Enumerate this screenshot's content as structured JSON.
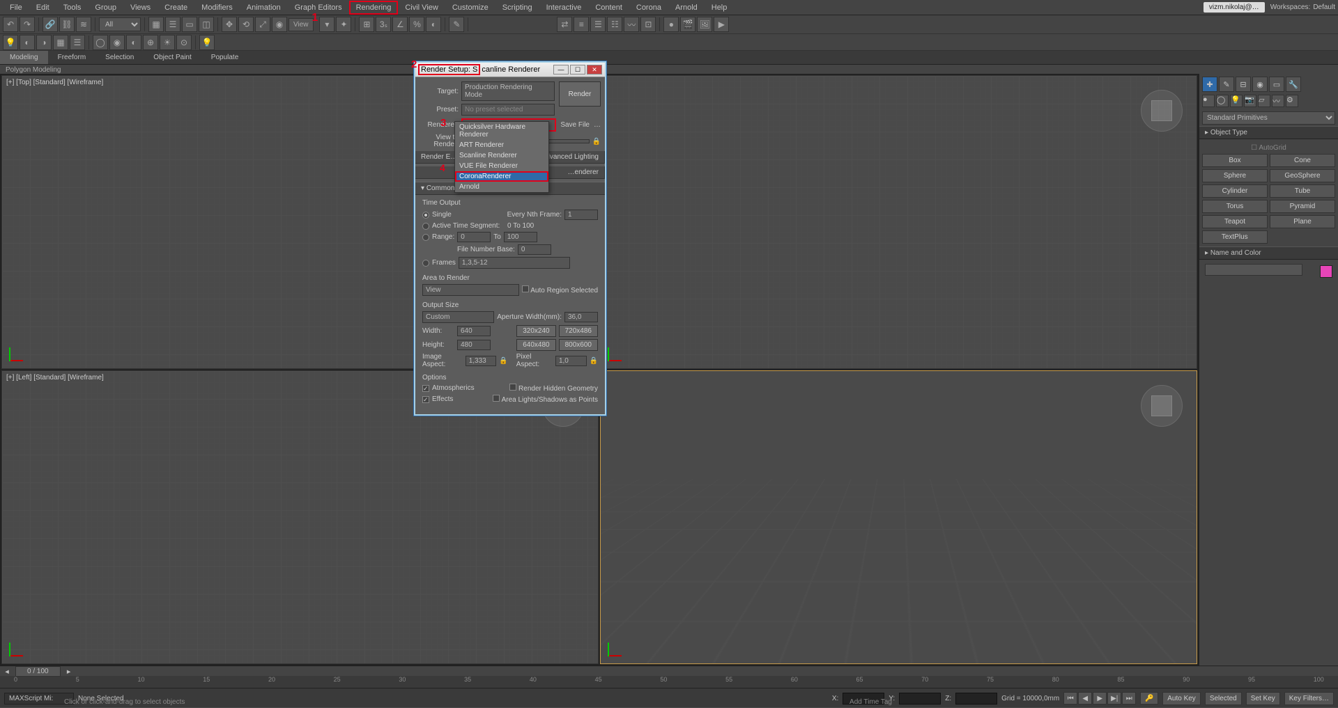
{
  "menu": [
    "File",
    "Edit",
    "Tools",
    "Group",
    "Views",
    "Create",
    "Modifiers",
    "Animation",
    "Graph Editors",
    "Rendering",
    "Civil View",
    "Customize",
    "Scripting",
    "Interactive",
    "Content",
    "Corona",
    "Arnold",
    "Help"
  ],
  "menu_hl_index": 9,
  "user": "vizm.nikolaj@…",
  "workspaces_label": "Workspaces:",
  "workspaces_value": "Default",
  "toolbar_filter": "All",
  "view_btn": "View",
  "ribbon_tabs": [
    "Modeling",
    "Freeform",
    "Selection",
    "Object Paint",
    "Populate"
  ],
  "ribbon_sub": "Polygon Modeling",
  "viewports": [
    {
      "label": "[+] [Top] [Standard] [Wireframe]"
    },
    {
      "label": ""
    },
    {
      "label": "[+] [Left] [Standard] [Wireframe]"
    },
    {
      "label": ""
    }
  ],
  "cmd": {
    "category": "Standard Primitives",
    "rollouts": {
      "object_type": "Object Type",
      "autogrid": "AutoGrid",
      "buttons": [
        "Box",
        "Cone",
        "Sphere",
        "GeoSphere",
        "Cylinder",
        "Tube",
        "Torus",
        "Pyramid",
        "Teapot",
        "Plane",
        "TextPlus"
      ],
      "name_color": "Name and Color"
    }
  },
  "timeline": {
    "frame": "0 / 100",
    "ticks": [
      "0",
      "5",
      "10",
      "15",
      "20",
      "25",
      "30",
      "35",
      "40",
      "45",
      "50",
      "55",
      "60",
      "65",
      "70",
      "75",
      "80",
      "85",
      "90",
      "95",
      "100"
    ],
    "status": "None Selected",
    "hint": "Click or click-and-drag to select objects",
    "maxscript": "MAXScript Mi:",
    "x": "X:",
    "y": "Y:",
    "z": "Z:",
    "grid": "Grid = 10000,0mm",
    "addtime": "Add Time Tag",
    "autokey": "Auto Key",
    "selected": "Selected",
    "setkey": "Set Key",
    "keyfilters": "Key Filters…"
  },
  "dialog": {
    "title_prefix": "Render Setup:",
    "title_suffix": "Scanline Renderer",
    "target_lbl": "Target:",
    "target_val": "Production Rendering Mode",
    "preset_lbl": "Preset:",
    "preset_val": "No preset selected",
    "renderer_lbl": "Renderer:",
    "renderer_val": "Scanline Renderer",
    "savefile": "Save File",
    "more": "…",
    "render_btn": "Render",
    "viewto_lbl": "View to Render:",
    "tabs": [
      "Render E…",
      "",
      "",
      "Advanced Lighting",
      "…enderer"
    ],
    "common_hdr": "Common Parameters",
    "time_hdr": "Time Output",
    "single": "Single",
    "every": "Every Nth Frame:",
    "every_val": "1",
    "active": "Active Time Segment:",
    "active_range": "0 To 100",
    "range": "Range:",
    "range_from": "0",
    "range_to_lbl": "To",
    "range_to": "100",
    "filebase": "File Number Base:",
    "filebase_val": "0",
    "frames": "Frames",
    "frames_val": "1,3,5-12",
    "area_hdr": "Area to Render",
    "area_val": "View",
    "autoregion": "Auto Region Selected",
    "out_hdr": "Output Size",
    "out_val": "Custom",
    "aperture": "Aperture Width(mm):",
    "aperture_val": "36,0",
    "width": "Width:",
    "width_val": "640",
    "height": "Height:",
    "height_val": "480",
    "presets": [
      "320x240",
      "720x486",
      "640x480",
      "800x600"
    ],
    "imgaspect": "Image Aspect:",
    "imgaspect_val": "1,333",
    "pixaspect": "Pixel Aspect:",
    "pixaspect_val": "1,0",
    "opt_hdr": "Options",
    "atmos": "Atmospherics",
    "hidden": "Render Hidden Geometry",
    "effects": "Effects",
    "arealights": "Area Lights/Shadows as Points"
  },
  "renderer_list": [
    "Quicksilver Hardware Renderer",
    "ART Renderer",
    "Scanline Renderer",
    "VUE File Renderer",
    "CoronaRenderer",
    "Arnold"
  ],
  "renderer_sel_index": 4,
  "annotations": {
    "1": "1",
    "2": "2",
    "3": "3",
    "4": "4"
  }
}
